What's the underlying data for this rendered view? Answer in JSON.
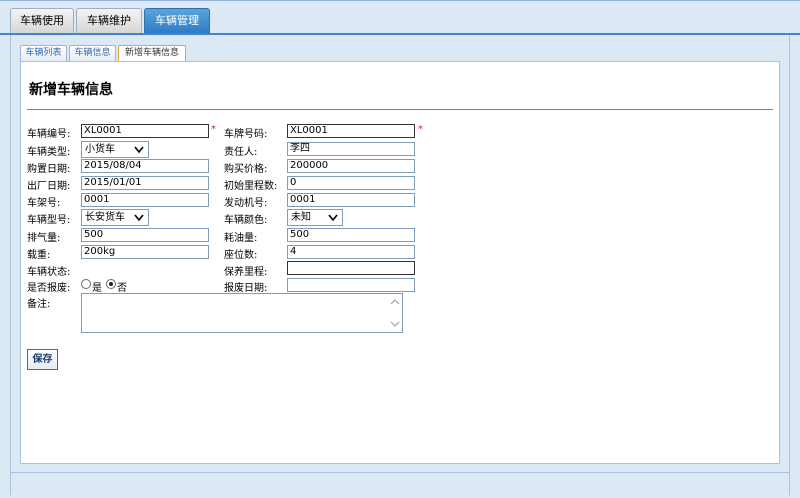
{
  "main_tabs": [
    {
      "label": "车辆使用",
      "active": false
    },
    {
      "label": "车辆维护",
      "active": false
    },
    {
      "label": "车辆管理",
      "active": true
    }
  ],
  "sub_tabs": [
    {
      "label": "车辆列表",
      "active": false
    },
    {
      "label": "车辆信息",
      "active": false
    },
    {
      "label": "新增车辆信息",
      "active": true
    }
  ],
  "page_title": "新增车辆信息",
  "form": {
    "vehicle_no": {
      "label": "车辆编号:",
      "value": "XL0001",
      "required": "*"
    },
    "plate_no": {
      "label": "车牌号码:",
      "value": "XL0001",
      "required": "*"
    },
    "vehicle_type": {
      "label": "车辆类型:",
      "value": "小货车"
    },
    "responsible": {
      "label": "责任人:",
      "value": "李四"
    },
    "purchase_date": {
      "label": "购置日期:",
      "value": "2015/08/04"
    },
    "purchase_price": {
      "label": "购买价格:",
      "value": "200000"
    },
    "factory_date": {
      "label": "出厂日期:",
      "value": "2015/01/01"
    },
    "initial_mileage": {
      "label": "初始里程数:",
      "value": "0"
    },
    "frame_no": {
      "label": "车架号:",
      "value": "0001"
    },
    "engine_no": {
      "label": "发动机号:",
      "value": "0001"
    },
    "vehicle_model": {
      "label": "车辆型号:",
      "value": "长安货车"
    },
    "vehicle_color": {
      "label": "车辆颜色:",
      "value": "未知"
    },
    "displacement": {
      "label": "排气量:",
      "value": "500"
    },
    "fuel_consumption": {
      "label": "耗油量:",
      "value": "500"
    },
    "load": {
      "label": "载重:",
      "value": "200kg"
    },
    "seats": {
      "label": "座位数:",
      "value": "4"
    },
    "vehicle_status": {
      "label": "车辆状态:"
    },
    "maintenance_mileage": {
      "label": "保养里程:",
      "value": ""
    },
    "scrapped": {
      "label": "是否报废:",
      "yes": "是",
      "no": "否",
      "selected": "no"
    },
    "scrap_date": {
      "label": "报废日期:",
      "value": ""
    },
    "remarks": {
      "label": "备注:",
      "value": ""
    }
  },
  "save_label": "保存",
  "icons": {
    "chevron": "chevron-down-icon",
    "scroll_up": "arrow-up-icon",
    "scroll_down": "arrow-down-icon"
  },
  "colors": {
    "active_tab": "#3f86cc",
    "required": "#e02020",
    "sub_tab_active_border": "#e6a23c",
    "background": "#dce9f5"
  }
}
